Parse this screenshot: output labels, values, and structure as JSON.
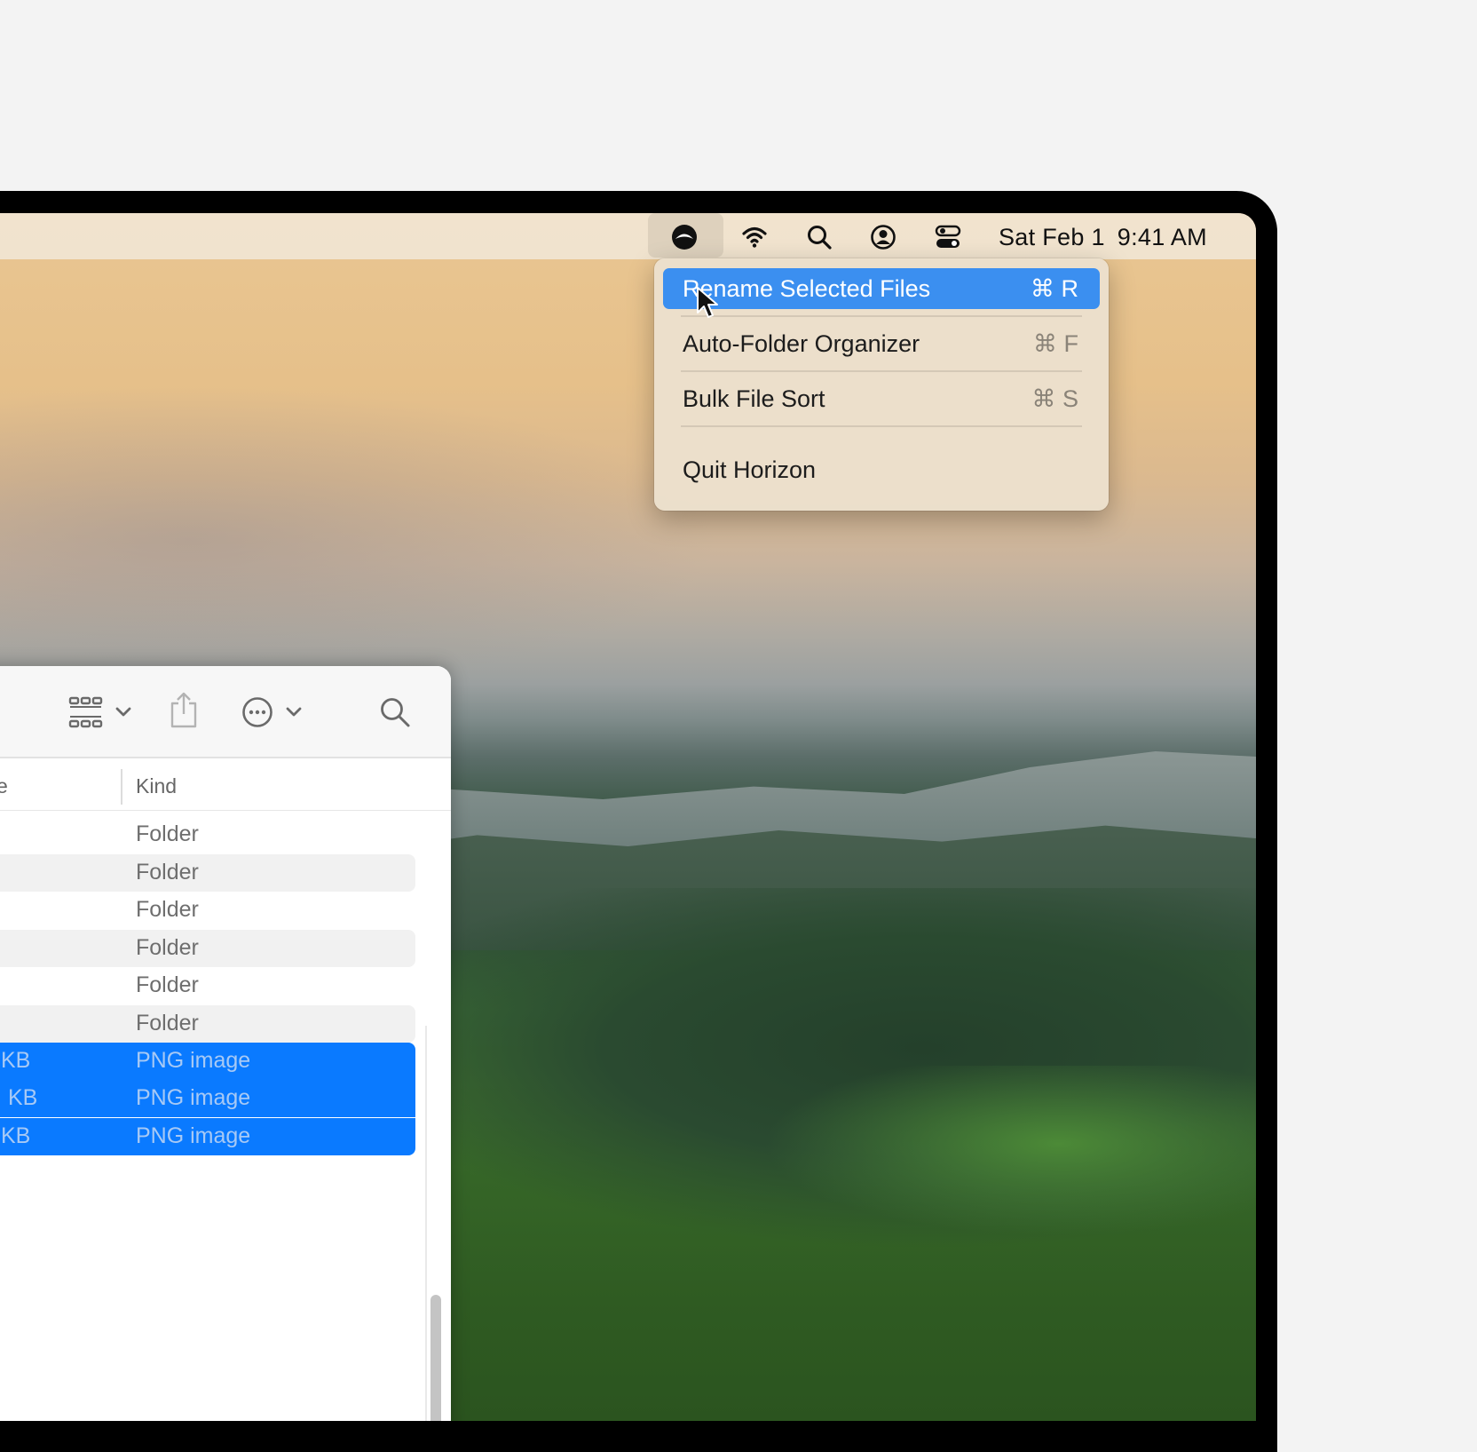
{
  "menubar": {
    "date": "Sat Feb 1",
    "time": "9:41 AM",
    "icons": [
      "horizon-app-icon",
      "wifi-icon",
      "search-icon",
      "user-icon",
      "control-center-icon"
    ]
  },
  "app_menu": {
    "items": [
      {
        "label": "Rename Selected Files",
        "shortcut": "⌘ R",
        "highlighted": true
      },
      {
        "label": "Auto-Folder Organizer",
        "shortcut": "⌘ F"
      },
      {
        "label": "Bulk File Sort",
        "shortcut": "⌘ S"
      },
      {
        "label": "Quit Horizon",
        "shortcut": ""
      }
    ]
  },
  "finder": {
    "toolbar_icons": [
      "view-grid-icon",
      "chevron-down-icon",
      "share-icon",
      "more-options-icon",
      "chevron-down-icon",
      "search-icon"
    ],
    "columns": {
      "size_fragment": "e",
      "kind": "Kind"
    },
    "rows": [
      {
        "size": "",
        "kind": "Folder"
      },
      {
        "size": "",
        "kind": "Folder"
      },
      {
        "size": "",
        "kind": "Folder"
      },
      {
        "size": "",
        "kind": "Folder"
      },
      {
        "size": "",
        "kind": "Folder"
      },
      {
        "size": "",
        "kind": "Folder"
      },
      {
        "size": "KB",
        "kind": "PNG image",
        "selected": true
      },
      {
        "size": "KB",
        "kind": "PNG image",
        "selected": true
      },
      {
        "size": "KB",
        "kind": "PNG image",
        "selected": true
      }
    ]
  },
  "colors": {
    "highlight": "#3b8ff0",
    "selection": "#0a7aff"
  }
}
